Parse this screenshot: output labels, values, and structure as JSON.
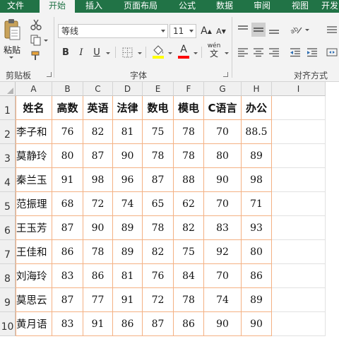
{
  "ribbon": {
    "tabs": [
      "文件",
      "开始",
      "插入",
      "页面布局",
      "公式",
      "数据",
      "审阅",
      "视图",
      "开发"
    ],
    "active_tab": "开始",
    "paste_label": "粘贴",
    "groups": {
      "clipboard": "剪贴板",
      "font": "字体",
      "alignment": "对齐方式"
    },
    "font_name": "等线",
    "font_size": "11",
    "bold_glyph": "B",
    "italic_glyph": "I",
    "underline_glyph": "U",
    "font_color_glyph": "A",
    "grow_font_glyph": "A",
    "shrink_font_glyph": "A",
    "phonetic_glyph": "wén",
    "colors": {
      "tab_bar": "#217346",
      "font_color": "#ff0000",
      "fill_color": "#ffff00",
      "table_border": "#f4b183"
    }
  },
  "sheet": {
    "columns": [
      "A",
      "B",
      "C",
      "D",
      "E",
      "F",
      "G",
      "H",
      "I"
    ],
    "rows": [
      "1",
      "2",
      "3",
      "4",
      "5",
      "6",
      "7",
      "8",
      "9",
      "10"
    ],
    "header": [
      "姓名",
      "高数",
      "英语",
      "法律",
      "数电",
      "模电",
      "C语言",
      "办公"
    ],
    "data": [
      [
        "李子和",
        "76",
        "82",
        "81",
        "75",
        "78",
        "70",
        "88.5"
      ],
      [
        "莫静玲",
        "80",
        "87",
        "90",
        "78",
        "78",
        "80",
        "89"
      ],
      [
        "秦兰玉",
        "91",
        "98",
        "96",
        "87",
        "88",
        "90",
        "98"
      ],
      [
        "范振理",
        "68",
        "72",
        "74",
        "65",
        "62",
        "70",
        "71"
      ],
      [
        "王玉芳",
        "87",
        "90",
        "89",
        "78",
        "82",
        "83",
        "93"
      ],
      [
        "王佳和",
        "86",
        "78",
        "89",
        "82",
        "75",
        "92",
        "80"
      ],
      [
        "刘海玲",
        "83",
        "86",
        "81",
        "76",
        "84",
        "70",
        "86"
      ],
      [
        "莫思云",
        "87",
        "77",
        "91",
        "72",
        "78",
        "74",
        "89"
      ],
      [
        "黄月语",
        "83",
        "91",
        "86",
        "87",
        "86",
        "90",
        "90"
      ]
    ]
  }
}
